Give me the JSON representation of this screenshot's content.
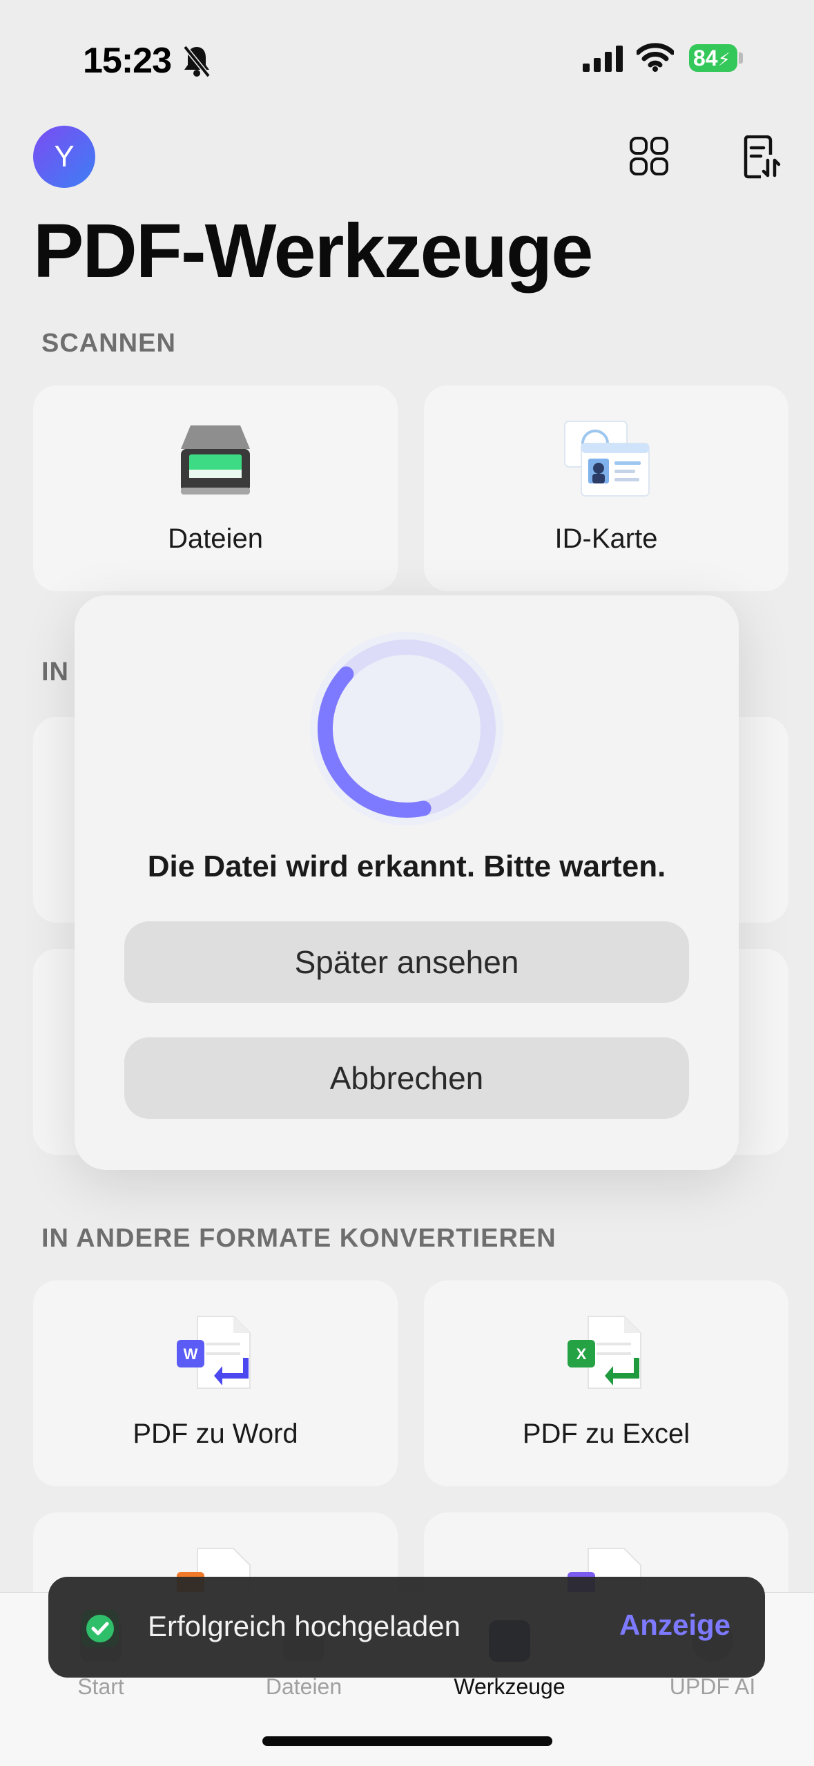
{
  "status_bar": {
    "time": "15:23",
    "battery": "84"
  },
  "header": {
    "avatar_initial": "Y",
    "title": "PDF-Werkzeuge"
  },
  "sections": {
    "scan": {
      "title": "SCANNEN",
      "cards": [
        "Dateien",
        "ID-Karte"
      ]
    },
    "hidden": {
      "title_fragment": "IN"
    },
    "convert": {
      "title": "IN ANDERE FORMATE KONVERTIEREN",
      "cards": [
        "PDF zu Word",
        "PDF zu Excel"
      ]
    }
  },
  "dialog": {
    "message": "Die Datei wird erkannt. Bitte warten.",
    "later_label": "Später ansehen",
    "cancel_label": "Abbrechen",
    "progress": 0.4
  },
  "tabbar": {
    "tabs": [
      "Start",
      "Dateien",
      "Werkzeuge",
      "UPDF AI"
    ],
    "active": "Werkzeuge"
  },
  "toast": {
    "message": "Erfolgreich hochgeladen",
    "action": "Anzeige"
  },
  "colors": {
    "accent": "#7d7aff",
    "success": "#34c759"
  }
}
